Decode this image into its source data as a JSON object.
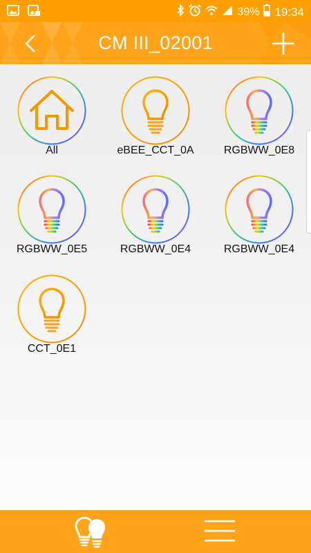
{
  "status_bar": {
    "battery_percent": "39%",
    "time": "19:34",
    "icons": [
      "gallery-icon",
      "photo-icon",
      "bluetooth-icon",
      "alarm-icon",
      "wifi-icon",
      "signal-icon",
      "battery-icon"
    ]
  },
  "header": {
    "title": "CM III_02001",
    "back_icon": "chevron-left-icon",
    "add_icon": "plus-icon"
  },
  "devices": [
    {
      "label": "All",
      "icon": "home-icon",
      "ring": "rainbow"
    },
    {
      "label": "eBEE_CCT_0A",
      "icon": "bulb-icon",
      "ring": "orange"
    },
    {
      "label": "RGBWW_0E8",
      "icon": "bulb-icon",
      "ring": "rainbow"
    },
    {
      "label": "RGBWW_0E5",
      "icon": "bulb-icon",
      "ring": "rainbow"
    },
    {
      "label": "RGBWW_0E4",
      "icon": "bulb-icon",
      "ring": "rainbow"
    },
    {
      "label": "RGBWW_0E4",
      "icon": "bulb-icon",
      "ring": "rainbow"
    },
    {
      "label": "CCT_0E1",
      "icon": "bulb-icon",
      "ring": "orange"
    }
  ],
  "bottom_bar": {
    "left_icon": "bulbs-icon",
    "right_icon": "menu-icon"
  },
  "colors": {
    "accent": "#ffa41a",
    "status_bar": "#ff9f00",
    "cct_orange": "#f7a21b"
  }
}
